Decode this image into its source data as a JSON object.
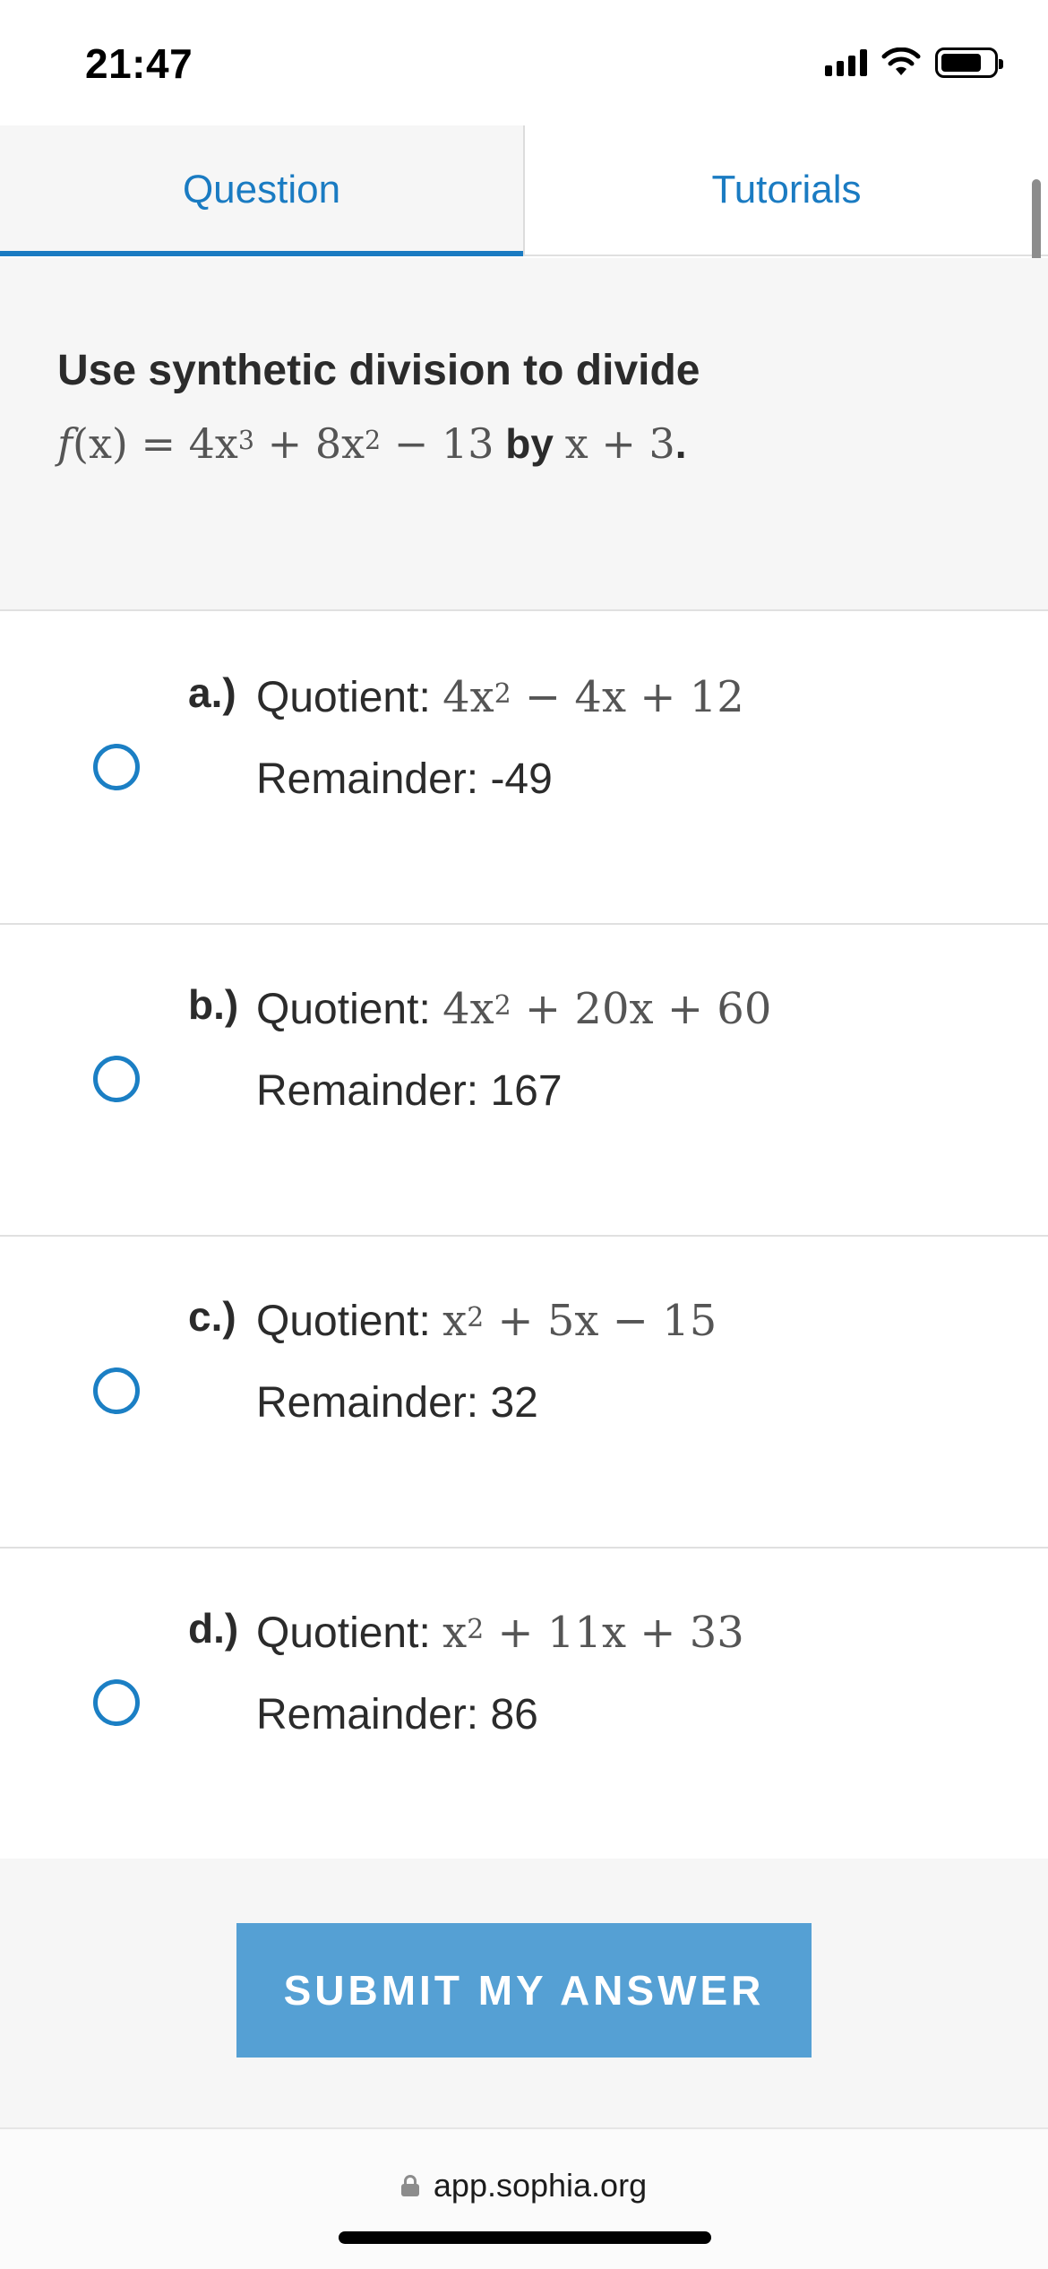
{
  "status_bar": {
    "time": "21:47",
    "icons": [
      "signal-icon",
      "wifi-icon",
      "battery-icon"
    ]
  },
  "tabs": [
    {
      "label": "Question",
      "active": true
    },
    {
      "label": "Tutorials",
      "active": false
    }
  ],
  "question": {
    "prompt": "Use synthetic division to divide",
    "function_name": "f",
    "function_arg": "(x)",
    "equals": " = 4x",
    "exp1": "3",
    "term2": " + 8x",
    "exp2": "2",
    "term3": " − 13",
    "by": " by ",
    "divisor": "x + 3",
    "end": "."
  },
  "options": [
    {
      "letter": "a.)",
      "quotient_label": "Quotient: ",
      "q_lead": "4x",
      "q_exp": "2",
      "q_rest": " − 4x + 12",
      "remainder": "Remainder: -49"
    },
    {
      "letter": "b.)",
      "quotient_label": "Quotient: ",
      "q_lead": "4x",
      "q_exp": "2",
      "q_rest": " + 20x + 60",
      "remainder": "Remainder: 167"
    },
    {
      "letter": "c.)",
      "quotient_label": "Quotient: ",
      "q_lead": "x",
      "q_exp": "2",
      "q_rest": " + 5x − 15",
      "remainder": "Remainder: 32"
    },
    {
      "letter": "d.)",
      "quotient_label": "Quotient: ",
      "q_lead": "x",
      "q_exp": "2",
      "q_rest": " + 11x + 33",
      "remainder": "Remainder: 86"
    }
  ],
  "submit": {
    "label": "SUBMIT MY ANSWER"
  },
  "browser": {
    "url": "app.sophia.org"
  },
  "colors": {
    "accent": "#1a7bc2",
    "submit_bg": "#55a0d4",
    "panel_bg": "#f6f6f6"
  }
}
